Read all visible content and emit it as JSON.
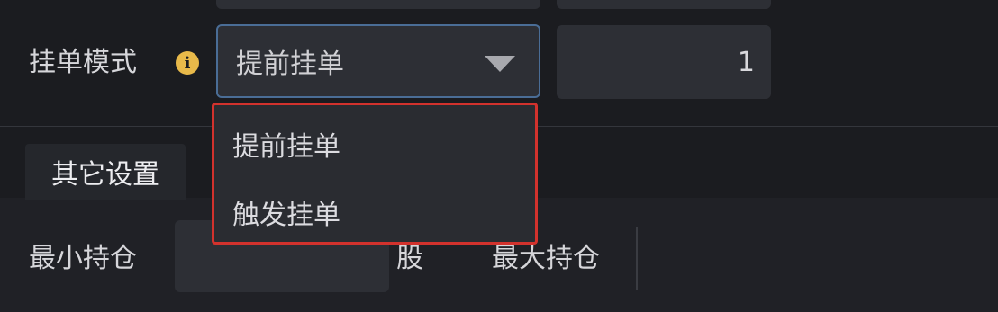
{
  "order_mode": {
    "label": "挂单模式",
    "info_icon": "info-icon",
    "select_value": "提前挂单",
    "number_value": "1",
    "options": [
      "提前挂单",
      "触发挂单"
    ]
  },
  "other_settings": {
    "tab_label": "其它设置",
    "min_position_label": "最小持仓",
    "unit_label": "股",
    "max_position_label": "最大持仓"
  },
  "colors": {
    "background": "#1b1c20",
    "field": "#2d2f35",
    "focus_border": "#4a6d96",
    "highlight_box": "#d2322d",
    "info_icon": "#e8b94a"
  }
}
